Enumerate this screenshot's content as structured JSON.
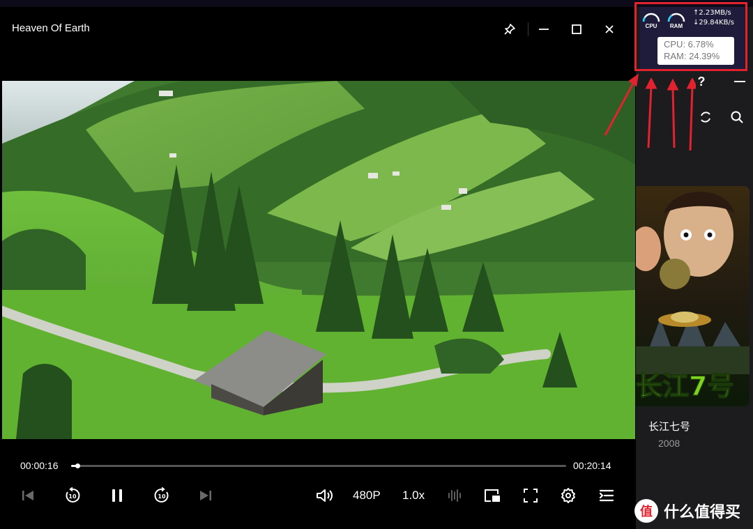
{
  "window": {
    "title": "Heaven Of Earth",
    "controls": [
      "pin",
      "minimize",
      "maximize",
      "close"
    ]
  },
  "playback": {
    "current_time": "00:00:16",
    "total_time": "00:20:14",
    "progress_fraction": 0.013,
    "quality_label": "480P",
    "speed_label": "1.0x"
  },
  "controls": {
    "left": [
      "previous-icon",
      "rewind-10-icon",
      "pause-icon",
      "forward-10-icon",
      "next-icon"
    ],
    "right": [
      "volume-icon",
      "audio-wave-icon",
      "picture-in-picture-icon",
      "fullscreen-icon",
      "settings-icon",
      "playlist-icon"
    ]
  },
  "monitor": {
    "cpu_label": "CPU",
    "ram_label": "RAM",
    "upload_speed": "↑2.23MB/s",
    "download_speed": "↓29.84KB/s",
    "tooltip_cpu": "CPU: 6.78%",
    "tooltip_ram": "RAM: 24.39%"
  },
  "side_panel": {
    "help": "?",
    "movie_title": "长江七号",
    "movie_year": "2008",
    "poster_text": "长江7号"
  },
  "watermark": {
    "logo_text": "值",
    "label": "什么值得买"
  },
  "colors": {
    "highlight": "#e2232f",
    "panel_bg": "#1c1c1e",
    "monitor_bg": "#1e1c3a"
  }
}
